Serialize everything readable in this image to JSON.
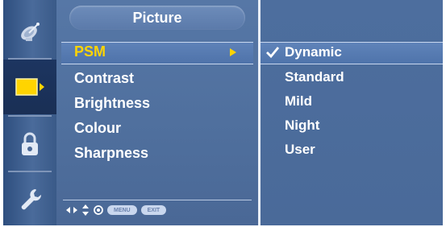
{
  "window": {
    "title": "Picture"
  },
  "sidebar": {
    "icons": [
      "satellite-dish-icon",
      "screen-icon",
      "lock-icon",
      "wrench-icon"
    ],
    "selected_index": 1
  },
  "menu": {
    "items": [
      {
        "label": "PSM",
        "highlighted": true
      },
      {
        "label": "Contrast"
      },
      {
        "label": "Brightness"
      },
      {
        "label": "Colour"
      },
      {
        "label": "Sharpness"
      }
    ]
  },
  "submenu": {
    "items": [
      {
        "label": "Dynamic",
        "checked": true
      },
      {
        "label": "Standard"
      },
      {
        "label": "Mild"
      },
      {
        "label": "Night"
      },
      {
        "label": "User"
      }
    ]
  },
  "footer": {
    "hint_icons": [
      "left-right-arrows-icon",
      "up-down-arrows-icon",
      "ok-button-icon"
    ],
    "menu_label": "MENU",
    "exit_label": "EXIT"
  },
  "colors": {
    "highlight_text": "#ffd400",
    "panel": "#4f6f9d",
    "sidebar_selected": "#1c3560"
  }
}
